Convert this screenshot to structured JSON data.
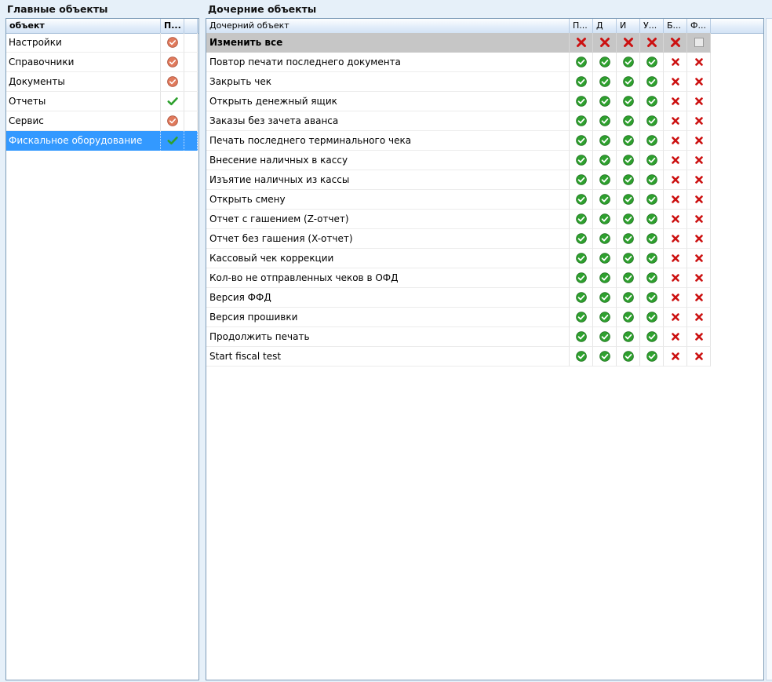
{
  "left": {
    "title": "Главные объекты",
    "col_name": "объект",
    "col_flag": "П...",
    "rows": [
      {
        "name": "Настройки",
        "state": "partial"
      },
      {
        "name": "Справочники",
        "state": "partial"
      },
      {
        "name": "Документы",
        "state": "partial"
      },
      {
        "name": "Отчеты",
        "state": "checked"
      },
      {
        "name": "Сервис",
        "state": "partial"
      },
      {
        "name": "Фискальное оборудование",
        "state": "checked",
        "selected": true
      }
    ]
  },
  "right": {
    "title": "Дочерние объекты",
    "col_name": "Дочерний объект",
    "perm_cols": [
      "П...",
      "Д",
      "И",
      "У...",
      "Б...",
      "Ф..."
    ],
    "change_all": {
      "name": "Изменить все",
      "values": [
        "deny",
        "deny",
        "deny",
        "deny",
        "deny",
        "empty"
      ]
    },
    "rows": [
      {
        "name": "Повтор печати последнего документа",
        "values": [
          "ok",
          "ok",
          "ok",
          "ok",
          "x",
          "x"
        ]
      },
      {
        "name": "Закрыть чек",
        "values": [
          "ok",
          "ok",
          "ok",
          "ok",
          "x",
          "x"
        ]
      },
      {
        "name": "Открыть денежный ящик",
        "values": [
          "ok",
          "ok",
          "ok",
          "ok",
          "x",
          "x"
        ]
      },
      {
        "name": "Заказы без зачета аванса",
        "values": [
          "ok",
          "ok",
          "ok",
          "ok",
          "x",
          "x"
        ]
      },
      {
        "name": "Печать последнего терминального чека",
        "values": [
          "ok",
          "ok",
          "ok",
          "ok",
          "x",
          "x"
        ]
      },
      {
        "name": "Внесение наличных в кассу",
        "values": [
          "ok",
          "ok",
          "ok",
          "ok",
          "x",
          "x"
        ]
      },
      {
        "name": "Изъятие наличных из кассы",
        "values": [
          "ok",
          "ok",
          "ok",
          "ok",
          "x",
          "x"
        ]
      },
      {
        "name": "Открыть смену",
        "values": [
          "ok",
          "ok",
          "ok",
          "ok",
          "x",
          "x"
        ]
      },
      {
        "name": "Отчет с гашением (Z-отчет)",
        "values": [
          "ok",
          "ok",
          "ok",
          "ok",
          "x",
          "x"
        ]
      },
      {
        "name": "Отчет без гашения (X-отчет)",
        "values": [
          "ok",
          "ok",
          "ok",
          "ok",
          "x",
          "x"
        ]
      },
      {
        "name": "Кассовый чек коррекции",
        "values": [
          "ok",
          "ok",
          "ok",
          "ok",
          "x",
          "x"
        ]
      },
      {
        "name": "Кол-во не отправленных чеков в ОФД",
        "values": [
          "ok",
          "ok",
          "ok",
          "ok",
          "x",
          "x"
        ]
      },
      {
        "name": "Версия ФФД",
        "values": [
          "ok",
          "ok",
          "ok",
          "ok",
          "x",
          "x"
        ]
      },
      {
        "name": "Версия прошивки",
        "values": [
          "ok",
          "ok",
          "ok",
          "ok",
          "x",
          "x"
        ]
      },
      {
        "name": "Продолжить печать",
        "values": [
          "ok",
          "ok",
          "ok",
          "ok",
          "x",
          "x"
        ]
      },
      {
        "name": "Start fiscal test",
        "values": [
          "ok",
          "ok",
          "ok",
          "ok",
          "x",
          "x"
        ]
      }
    ]
  },
  "colors": {
    "selection": "#3399ff",
    "ok": "#2ea02e",
    "deny": "#cc1111",
    "partial": "#e07a5c"
  }
}
